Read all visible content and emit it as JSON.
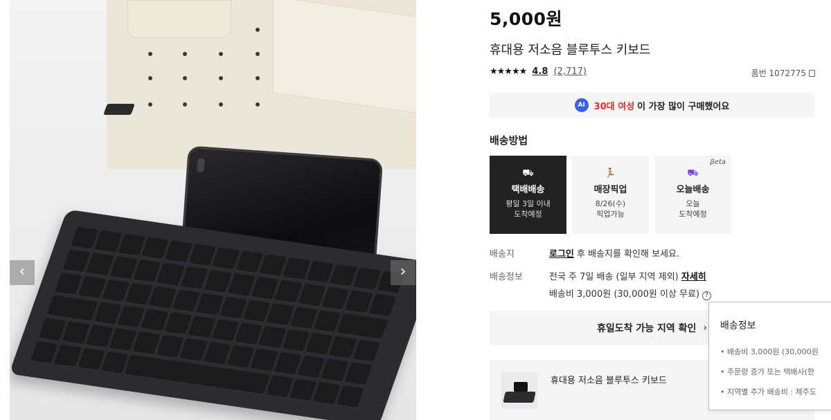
{
  "gallery": {
    "prev_label": "‹",
    "next_label": "›"
  },
  "product": {
    "price": "5,000원",
    "title": "휴대용 저소음 블루투스 키보드",
    "stars": "★★★★★",
    "rating": "4.8",
    "review_count": "(2,717)",
    "item_number": "품번 1072775"
  },
  "ai_banner": {
    "badge": "AI",
    "highlight": "30대 여성",
    "text": "이 가장 많이 구매했어요"
  },
  "shipping": {
    "heading": "배송방법",
    "options": [
      {
        "icon": "truck-icon",
        "name": "택배배송",
        "line1": "평일 3일 이내",
        "line2": "도착예정",
        "selected": true
      },
      {
        "icon": "runner-icon",
        "name": "매장픽업",
        "line1": "8/26(수)",
        "line2": "픽업가능",
        "selected": false
      },
      {
        "icon": "today-delivery-icon",
        "name": "오늘배송",
        "line1": "오늘",
        "line2": "도착예정",
        "badge": "βeta",
        "selected": false
      }
    ],
    "destination_label": "배송지",
    "destination_link": "로그인",
    "destination_text": "후 배송지를 확인해 보세요.",
    "info_label": "배송정보",
    "info_text": "전국 주 7일 배송 (일부 지역 제외)",
    "info_link": "자세히",
    "fee_text": "배송비 3,000원 (30,000원 이상 무료)",
    "help_glyph": "?"
  },
  "holiday_button": {
    "label": "휴일도착 가능 지역 확인",
    "chevron": "›"
  },
  "product_card": {
    "title": "휴대용 저소음 블루투스 키보드"
  },
  "tooltip": {
    "title": "배송정보",
    "items": [
      "• 배송비 3,000원 (30,000원",
      "• 주문량 증가 또는 택배사(한",
      "• 지역별 추가 배송비 : 제주도"
    ]
  },
  "colors": {
    "accent_red": "#e8302a",
    "ai_blue": "#3563e9",
    "today_purple": "#7b3fe4",
    "selected_card": "#222222",
    "panel_bg": "#f5f5f6"
  }
}
